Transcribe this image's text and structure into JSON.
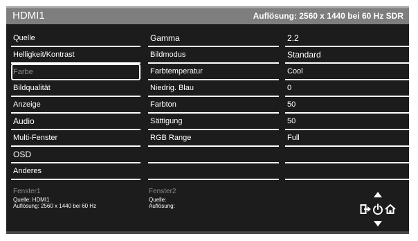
{
  "header": {
    "input": "HDMI1",
    "resolution": "Auflösung: 2560 x 1440 bei 60 Hz SDR"
  },
  "main_menu": [
    {
      "label": "Quelle"
    },
    {
      "label": "Helligkeit/Kontrast"
    },
    {
      "label": "Farbe"
    },
    {
      "label": "Bildqualität"
    },
    {
      "label": "Anzeige"
    },
    {
      "label": "Audio"
    },
    {
      "label": "Multi-Fenster"
    },
    {
      "label": "OSD"
    },
    {
      "label": "Anderes"
    }
  ],
  "sub_menu": [
    {
      "label": "Gamma"
    },
    {
      "label": "Bildmodus"
    },
    {
      "label": "Farbtemperatur"
    },
    {
      "label": "Niedrig. Blau"
    },
    {
      "label": "Farbton"
    },
    {
      "label": "Sättigung"
    },
    {
      "label": "RGB Range"
    },
    {
      "label": ""
    },
    {
      "label": ""
    }
  ],
  "values": [
    {
      "label": "2.2"
    },
    {
      "label": "Standard"
    },
    {
      "label": "Cool"
    },
    {
      "label": "0"
    },
    {
      "label": "50"
    },
    {
      "label": "50"
    },
    {
      "label": "Full"
    },
    {
      "label": ""
    },
    {
      "label": ""
    }
  ],
  "window1": {
    "title": "Fenster1",
    "source": "Quelle: HDMI1",
    "resolution": "Auflösung: 2560 x 1440 bei 60 Hz"
  },
  "window2": {
    "title": "Fenster2",
    "source": "Quelle:",
    "resolution": "Auflösung:"
  },
  "keys": {
    "up": "up-arrow-icon",
    "exit": "exit-icon",
    "power": "power-icon",
    "home": "home-icon",
    "down": "down-arrow-icon"
  },
  "colors": {
    "panel": "#1c1c1c",
    "header": "#7e7e7e",
    "dimmed_text": "#8a8a8a"
  }
}
